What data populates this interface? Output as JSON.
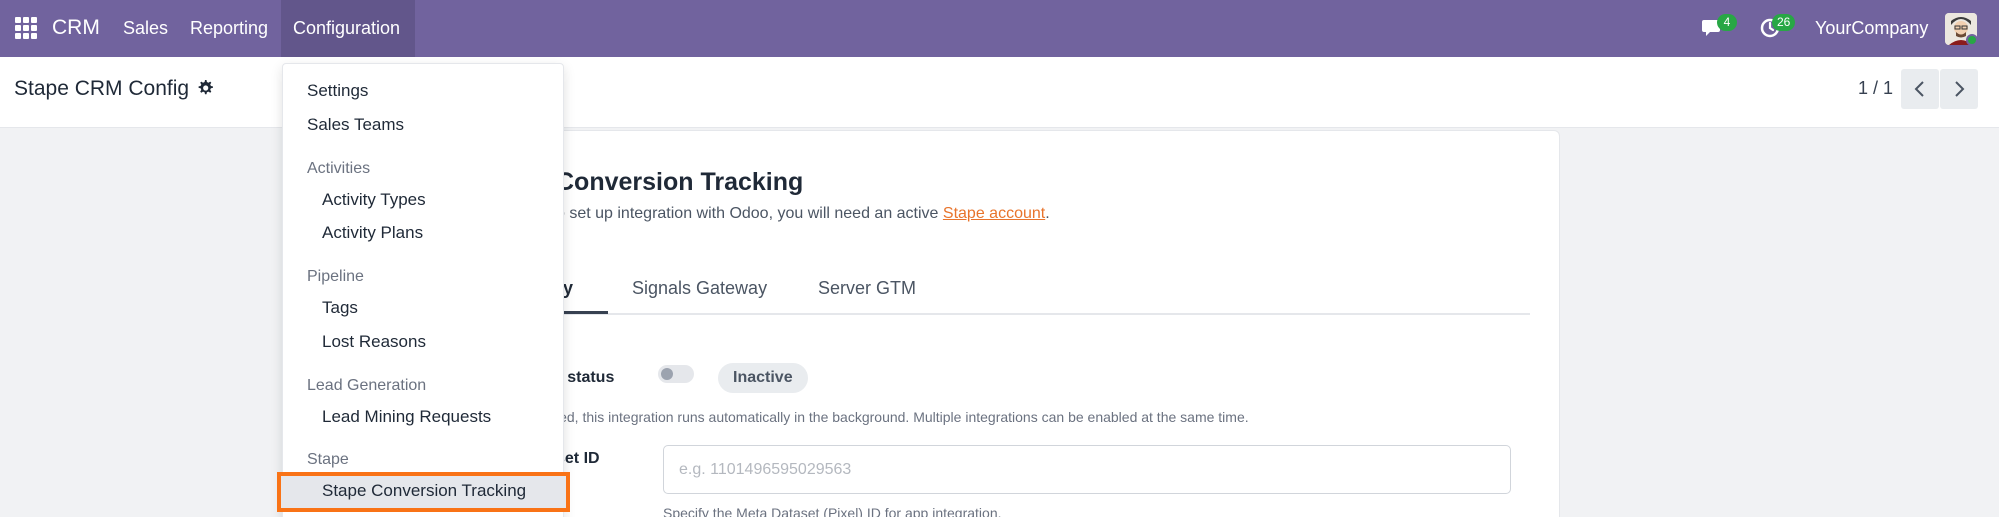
{
  "navbar": {
    "brand": "CRM",
    "menu": [
      "Sales",
      "Reporting",
      "Configuration"
    ],
    "messages_count": "4",
    "activities_count": "26",
    "company": "YourCompany"
  },
  "control_panel": {
    "title": "Stape CRM Config",
    "pager": "1 / 1"
  },
  "card": {
    "title_visible": "Conversion Tracking",
    "desc_prefix": "o set up integration with Odoo, you will need an active ",
    "desc_link": "Stape account",
    "desc_suffix": ".",
    "tabs": [
      "ay",
      "Signals Gateway",
      "Server GTM"
    ],
    "status_label": "n status",
    "status_value": "Inactive",
    "status_help": "led, this integration runs automatically in the background. Multiple integrations can be enabled at the same time.",
    "dataset_label": "set ID",
    "dataset_placeholder": "e.g. 1101496595029563",
    "dataset_help": "Specify the Meta Dataset (Pixel) ID for app integration."
  },
  "dropdown": {
    "settings": "Settings",
    "sales_teams": "Sales Teams",
    "activities_header": "Activities",
    "activity_types": "Activity Types",
    "activity_plans": "Activity Plans",
    "pipeline_header": "Pipeline",
    "tags": "Tags",
    "lost_reasons": "Lost Reasons",
    "lead_gen_header": "Lead Generation",
    "lead_mining": "Lead Mining Requests",
    "stape_header": "Stape",
    "stape_tracking": "Stape Conversion Tracking"
  },
  "colors": {
    "navbar": "#71639e",
    "highlight": "#f97316",
    "link": "#e8742c",
    "badge": "#28a745"
  }
}
